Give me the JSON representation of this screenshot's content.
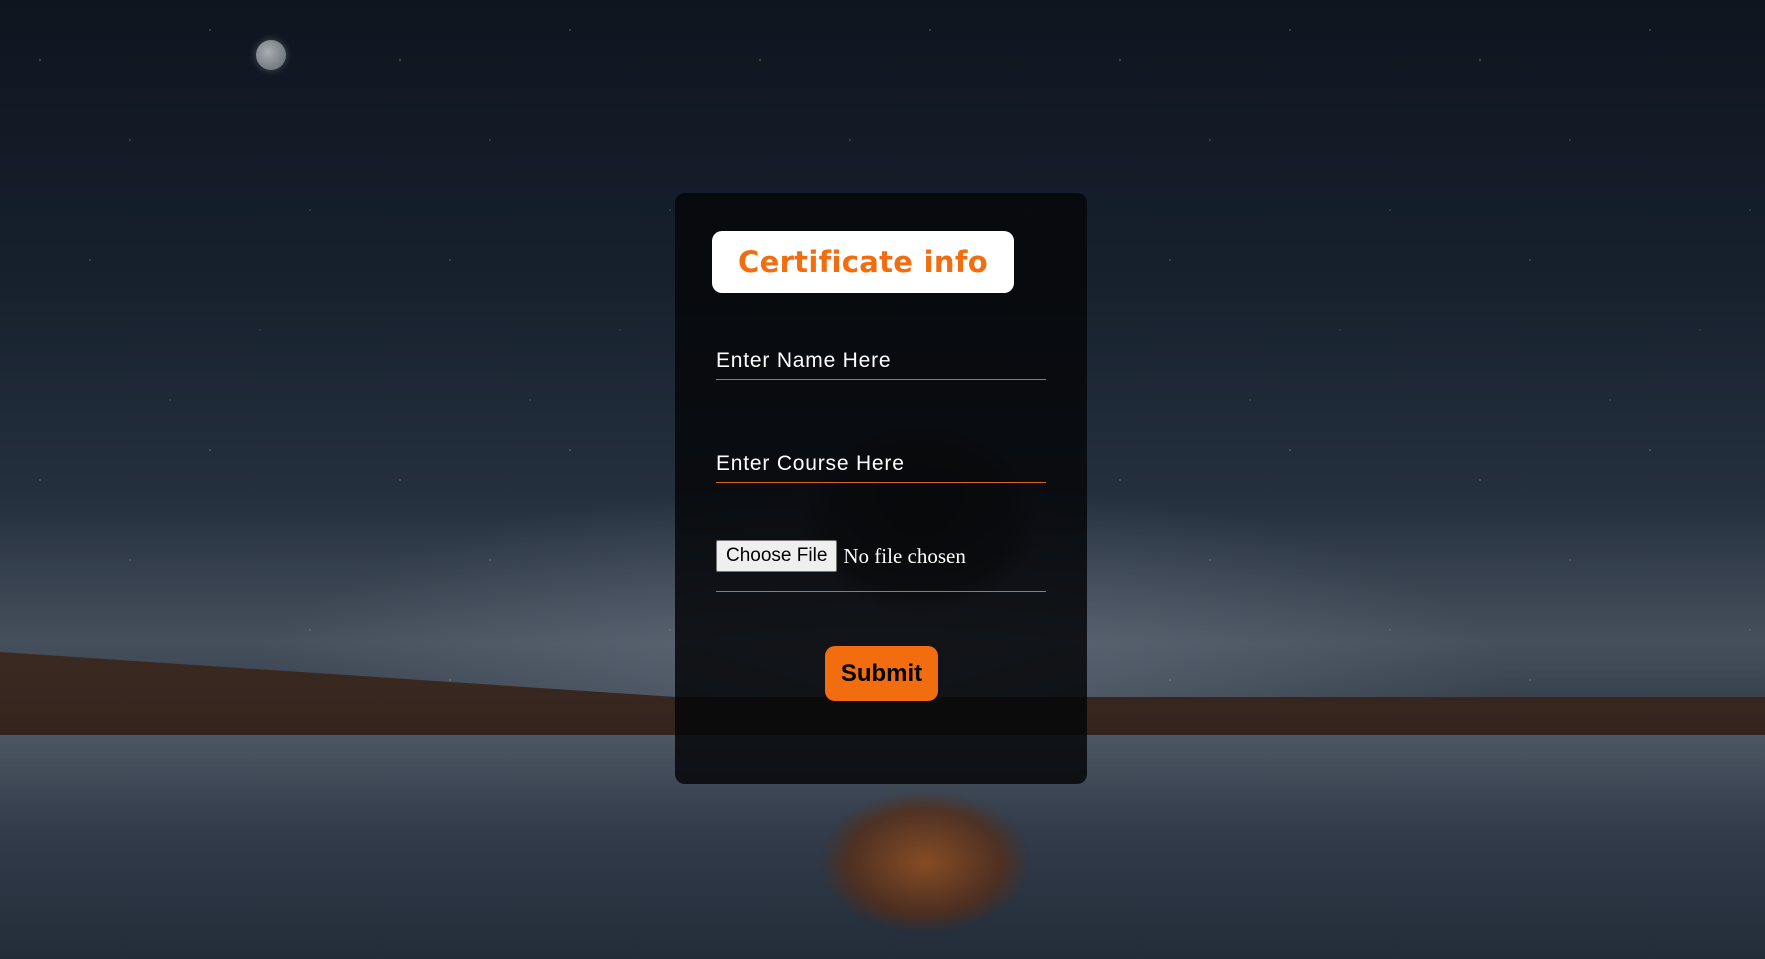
{
  "form": {
    "title": "Certificate info",
    "name_placeholder": "Enter Name Here",
    "course_placeholder": "Enter Course Here",
    "file_button_label": "Choose File",
    "file_status": "No file chosen",
    "submit_label": "Submit"
  },
  "colors": {
    "accent": "#f26d0f",
    "card_background": "#060709",
    "title_background": "#ffffff",
    "text": "#ffffff"
  }
}
